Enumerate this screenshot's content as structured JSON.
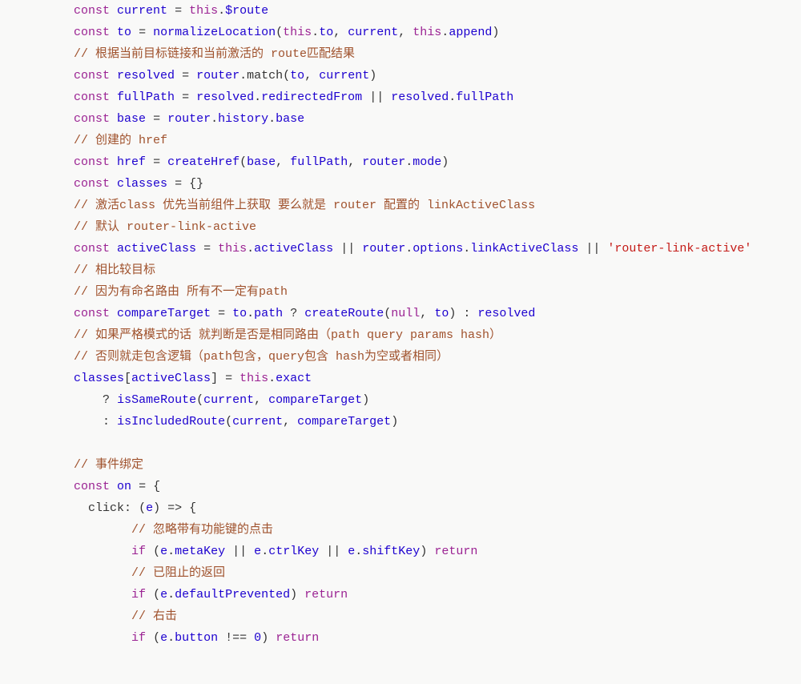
{
  "code": {
    "lines": [
      {
        "indent": 4,
        "tokens": [
          {
            "t": "kw",
            "v": "const"
          },
          {
            "t": "plain",
            "v": " "
          },
          {
            "t": "var",
            "v": "current"
          },
          {
            "t": "plain",
            "v": " "
          },
          {
            "t": "punct",
            "v": "="
          },
          {
            "t": "plain",
            "v": " "
          },
          {
            "t": "kw",
            "v": "this"
          },
          {
            "t": "punct",
            "v": "."
          },
          {
            "t": "var",
            "v": "$route"
          }
        ]
      },
      {
        "indent": 4,
        "tokens": [
          {
            "t": "kw",
            "v": "const"
          },
          {
            "t": "plain",
            "v": " "
          },
          {
            "t": "var",
            "v": "to"
          },
          {
            "t": "plain",
            "v": " "
          },
          {
            "t": "punct",
            "v": "="
          },
          {
            "t": "plain",
            "v": " "
          },
          {
            "t": "var",
            "v": "normalizeLocation"
          },
          {
            "t": "punct",
            "v": "("
          },
          {
            "t": "kw",
            "v": "this"
          },
          {
            "t": "punct",
            "v": "."
          },
          {
            "t": "var",
            "v": "to"
          },
          {
            "t": "punct",
            "v": ","
          },
          {
            "t": "plain",
            "v": " "
          },
          {
            "t": "var",
            "v": "current"
          },
          {
            "t": "punct",
            "v": ","
          },
          {
            "t": "plain",
            "v": " "
          },
          {
            "t": "kw",
            "v": "this"
          },
          {
            "t": "punct",
            "v": "."
          },
          {
            "t": "var",
            "v": "append"
          },
          {
            "t": "punct",
            "v": ")"
          }
        ]
      },
      {
        "indent": 4,
        "tokens": [
          {
            "t": "cmt",
            "v": "// 根据当前目标链接和当前激活的 route匹配结果"
          }
        ]
      },
      {
        "indent": 4,
        "tokens": [
          {
            "t": "kw",
            "v": "const"
          },
          {
            "t": "plain",
            "v": " "
          },
          {
            "t": "var",
            "v": "resolved"
          },
          {
            "t": "plain",
            "v": " "
          },
          {
            "t": "punct",
            "v": "="
          },
          {
            "t": "plain",
            "v": " "
          },
          {
            "t": "var",
            "v": "router"
          },
          {
            "t": "punct",
            "v": "."
          },
          {
            "t": "prop",
            "v": "match"
          },
          {
            "t": "punct",
            "v": "("
          },
          {
            "t": "var",
            "v": "to"
          },
          {
            "t": "punct",
            "v": ","
          },
          {
            "t": "plain",
            "v": " "
          },
          {
            "t": "var",
            "v": "current"
          },
          {
            "t": "punct",
            "v": ")"
          }
        ]
      },
      {
        "indent": 4,
        "tokens": [
          {
            "t": "kw",
            "v": "const"
          },
          {
            "t": "plain",
            "v": " "
          },
          {
            "t": "var",
            "v": "fullPath"
          },
          {
            "t": "plain",
            "v": " "
          },
          {
            "t": "punct",
            "v": "="
          },
          {
            "t": "plain",
            "v": " "
          },
          {
            "t": "var",
            "v": "resolved"
          },
          {
            "t": "punct",
            "v": "."
          },
          {
            "t": "var",
            "v": "redirectedFrom"
          },
          {
            "t": "plain",
            "v": " "
          },
          {
            "t": "punct",
            "v": "||"
          },
          {
            "t": "plain",
            "v": " "
          },
          {
            "t": "var",
            "v": "resolved"
          },
          {
            "t": "punct",
            "v": "."
          },
          {
            "t": "var",
            "v": "fullPath"
          }
        ]
      },
      {
        "indent": 4,
        "tokens": [
          {
            "t": "kw",
            "v": "const"
          },
          {
            "t": "plain",
            "v": " "
          },
          {
            "t": "var",
            "v": "base"
          },
          {
            "t": "plain",
            "v": " "
          },
          {
            "t": "punct",
            "v": "="
          },
          {
            "t": "plain",
            "v": " "
          },
          {
            "t": "var",
            "v": "router"
          },
          {
            "t": "punct",
            "v": "."
          },
          {
            "t": "var",
            "v": "history"
          },
          {
            "t": "punct",
            "v": "."
          },
          {
            "t": "var",
            "v": "base"
          }
        ]
      },
      {
        "indent": 4,
        "tokens": [
          {
            "t": "cmt",
            "v": "// 创建的 href"
          }
        ]
      },
      {
        "indent": 4,
        "tokens": [
          {
            "t": "kw",
            "v": "const"
          },
          {
            "t": "plain",
            "v": " "
          },
          {
            "t": "var",
            "v": "href"
          },
          {
            "t": "plain",
            "v": " "
          },
          {
            "t": "punct",
            "v": "="
          },
          {
            "t": "plain",
            "v": " "
          },
          {
            "t": "var",
            "v": "createHref"
          },
          {
            "t": "punct",
            "v": "("
          },
          {
            "t": "var",
            "v": "base"
          },
          {
            "t": "punct",
            "v": ","
          },
          {
            "t": "plain",
            "v": " "
          },
          {
            "t": "var",
            "v": "fullPath"
          },
          {
            "t": "punct",
            "v": ","
          },
          {
            "t": "plain",
            "v": " "
          },
          {
            "t": "var",
            "v": "router"
          },
          {
            "t": "punct",
            "v": "."
          },
          {
            "t": "var",
            "v": "mode"
          },
          {
            "t": "punct",
            "v": ")"
          }
        ]
      },
      {
        "indent": 4,
        "tokens": [
          {
            "t": "kw",
            "v": "const"
          },
          {
            "t": "plain",
            "v": " "
          },
          {
            "t": "var",
            "v": "classes"
          },
          {
            "t": "plain",
            "v": " "
          },
          {
            "t": "punct",
            "v": "="
          },
          {
            "t": "plain",
            "v": " "
          },
          {
            "t": "punct",
            "v": "{}"
          }
        ]
      },
      {
        "indent": 4,
        "tokens": [
          {
            "t": "cmt",
            "v": "// 激活class 优先当前组件上获取 要么就是 router 配置的 linkActiveClass"
          }
        ]
      },
      {
        "indent": 4,
        "tokens": [
          {
            "t": "cmt",
            "v": "// 默认 router-link-active"
          }
        ]
      },
      {
        "indent": 4,
        "wrap": true,
        "tokens": [
          {
            "t": "kw",
            "v": "const"
          },
          {
            "t": "plain",
            "v": " "
          },
          {
            "t": "var",
            "v": "activeClass"
          },
          {
            "t": "plain",
            "v": " "
          },
          {
            "t": "punct",
            "v": "="
          },
          {
            "t": "plain",
            "v": " "
          },
          {
            "t": "kw",
            "v": "this"
          },
          {
            "t": "punct",
            "v": "."
          },
          {
            "t": "var",
            "v": "activeClass"
          },
          {
            "t": "plain",
            "v": " "
          },
          {
            "t": "punct",
            "v": "||"
          },
          {
            "t": "plain",
            "v": " "
          },
          {
            "t": "var",
            "v": "router"
          },
          {
            "t": "punct",
            "v": "."
          },
          {
            "t": "var",
            "v": "options"
          },
          {
            "t": "punct",
            "v": "."
          },
          {
            "t": "var",
            "v": "linkActiveClass"
          },
          {
            "t": "plain",
            "v": " "
          },
          {
            "t": "punct",
            "v": "||"
          },
          {
            "t": "plain",
            "v": " "
          },
          {
            "t": "str",
            "v": "'router-link-active'"
          }
        ]
      },
      {
        "indent": 4,
        "tokens": [
          {
            "t": "cmt",
            "v": "// 相比较目标"
          }
        ]
      },
      {
        "indent": 4,
        "tokens": [
          {
            "t": "cmt",
            "v": "// 因为有命名路由 所有不一定有path"
          }
        ]
      },
      {
        "indent": 4,
        "tokens": [
          {
            "t": "kw",
            "v": "const"
          },
          {
            "t": "plain",
            "v": " "
          },
          {
            "t": "var",
            "v": "compareTarget"
          },
          {
            "t": "plain",
            "v": " "
          },
          {
            "t": "punct",
            "v": "="
          },
          {
            "t": "plain",
            "v": " "
          },
          {
            "t": "var",
            "v": "to"
          },
          {
            "t": "punct",
            "v": "."
          },
          {
            "t": "var",
            "v": "path"
          },
          {
            "t": "plain",
            "v": " "
          },
          {
            "t": "punct",
            "v": "?"
          },
          {
            "t": "plain",
            "v": " "
          },
          {
            "t": "var",
            "v": "createRoute"
          },
          {
            "t": "punct",
            "v": "("
          },
          {
            "t": "kw",
            "v": "null"
          },
          {
            "t": "punct",
            "v": ","
          },
          {
            "t": "plain",
            "v": " "
          },
          {
            "t": "var",
            "v": "to"
          },
          {
            "t": "punct",
            "v": ")"
          },
          {
            "t": "plain",
            "v": " "
          },
          {
            "t": "punct",
            "v": ":"
          },
          {
            "t": "plain",
            "v": " "
          },
          {
            "t": "var",
            "v": "resolved"
          }
        ]
      },
      {
        "indent": 4,
        "tokens": [
          {
            "t": "cmt",
            "v": "// 如果严格模式的话 就判断是否是相同路由（path query params hash）"
          }
        ]
      },
      {
        "indent": 4,
        "tokens": [
          {
            "t": "cmt",
            "v": "// 否则就走包含逻辑（path包含，query包含 hash为空或者相同）"
          }
        ]
      },
      {
        "indent": 4,
        "tokens": [
          {
            "t": "var",
            "v": "classes"
          },
          {
            "t": "punct",
            "v": "["
          },
          {
            "t": "var",
            "v": "activeClass"
          },
          {
            "t": "punct",
            "v": "]"
          },
          {
            "t": "plain",
            "v": " "
          },
          {
            "t": "punct",
            "v": "="
          },
          {
            "t": "plain",
            "v": " "
          },
          {
            "t": "kw",
            "v": "this"
          },
          {
            "t": "punct",
            "v": "."
          },
          {
            "t": "var",
            "v": "exact"
          }
        ]
      },
      {
        "indent": 6,
        "tokens": [
          {
            "t": "punct",
            "v": "?"
          },
          {
            "t": "plain",
            "v": " "
          },
          {
            "t": "var",
            "v": "isSameRoute"
          },
          {
            "t": "punct",
            "v": "("
          },
          {
            "t": "var",
            "v": "current"
          },
          {
            "t": "punct",
            "v": ","
          },
          {
            "t": "plain",
            "v": " "
          },
          {
            "t": "var",
            "v": "compareTarget"
          },
          {
            "t": "punct",
            "v": ")"
          }
        ]
      },
      {
        "indent": 6,
        "tokens": [
          {
            "t": "punct",
            "v": ":"
          },
          {
            "t": "plain",
            "v": " "
          },
          {
            "t": "var",
            "v": "isIncludedRoute"
          },
          {
            "t": "punct",
            "v": "("
          },
          {
            "t": "var",
            "v": "current"
          },
          {
            "t": "punct",
            "v": ","
          },
          {
            "t": "plain",
            "v": " "
          },
          {
            "t": "var",
            "v": "compareTarget"
          },
          {
            "t": "punct",
            "v": ")"
          }
        ]
      },
      {
        "indent": 0,
        "tokens": []
      },
      {
        "indent": 4,
        "tokens": [
          {
            "t": "cmt",
            "v": "// 事件绑定"
          }
        ]
      },
      {
        "indent": 4,
        "tokens": [
          {
            "t": "kw",
            "v": "const"
          },
          {
            "t": "plain",
            "v": " "
          },
          {
            "t": "var",
            "v": "on"
          },
          {
            "t": "plain",
            "v": " "
          },
          {
            "t": "punct",
            "v": "="
          },
          {
            "t": "plain",
            "v": " "
          },
          {
            "t": "punct",
            "v": "{"
          }
        ]
      },
      {
        "indent": 5,
        "tokens": [
          {
            "t": "prop",
            "v": "click"
          },
          {
            "t": "punct",
            "v": ":"
          },
          {
            "t": "plain",
            "v": " "
          },
          {
            "t": "punct",
            "v": "("
          },
          {
            "t": "var",
            "v": "e"
          },
          {
            "t": "punct",
            "v": ")"
          },
          {
            "t": "plain",
            "v": " "
          },
          {
            "t": "punct",
            "v": "=>"
          },
          {
            "t": "plain",
            "v": " "
          },
          {
            "t": "punct",
            "v": "{"
          }
        ]
      },
      {
        "indent": 8,
        "tokens": [
          {
            "t": "cmt",
            "v": "// 忽略带有功能键的点击"
          }
        ]
      },
      {
        "indent": 8,
        "tokens": [
          {
            "t": "kw",
            "v": "if"
          },
          {
            "t": "plain",
            "v": " "
          },
          {
            "t": "punct",
            "v": "("
          },
          {
            "t": "var",
            "v": "e"
          },
          {
            "t": "punct",
            "v": "."
          },
          {
            "t": "var",
            "v": "metaKey"
          },
          {
            "t": "plain",
            "v": " "
          },
          {
            "t": "punct",
            "v": "||"
          },
          {
            "t": "plain",
            "v": " "
          },
          {
            "t": "var",
            "v": "e"
          },
          {
            "t": "punct",
            "v": "."
          },
          {
            "t": "var",
            "v": "ctrlKey"
          },
          {
            "t": "plain",
            "v": " "
          },
          {
            "t": "punct",
            "v": "||"
          },
          {
            "t": "plain",
            "v": " "
          },
          {
            "t": "var",
            "v": "e"
          },
          {
            "t": "punct",
            "v": "."
          },
          {
            "t": "var",
            "v": "shiftKey"
          },
          {
            "t": "punct",
            "v": ")"
          },
          {
            "t": "plain",
            "v": " "
          },
          {
            "t": "kw",
            "v": "return"
          }
        ]
      },
      {
        "indent": 8,
        "tokens": [
          {
            "t": "cmt",
            "v": "// 已阻止的返回"
          }
        ]
      },
      {
        "indent": 8,
        "tokens": [
          {
            "t": "kw",
            "v": "if"
          },
          {
            "t": "plain",
            "v": " "
          },
          {
            "t": "punct",
            "v": "("
          },
          {
            "t": "var",
            "v": "e"
          },
          {
            "t": "punct",
            "v": "."
          },
          {
            "t": "var",
            "v": "defaultPrevented"
          },
          {
            "t": "punct",
            "v": ")"
          },
          {
            "t": "plain",
            "v": " "
          },
          {
            "t": "kw",
            "v": "return"
          }
        ]
      },
      {
        "indent": 8,
        "tokens": [
          {
            "t": "cmt",
            "v": "// 右击"
          }
        ]
      },
      {
        "indent": 8,
        "tokens": [
          {
            "t": "kw",
            "v": "if"
          },
          {
            "t": "plain",
            "v": " "
          },
          {
            "t": "punct",
            "v": "("
          },
          {
            "t": "var",
            "v": "e"
          },
          {
            "t": "punct",
            "v": "."
          },
          {
            "t": "var",
            "v": "button"
          },
          {
            "t": "plain",
            "v": " "
          },
          {
            "t": "punct",
            "v": "!=="
          },
          {
            "t": "plain",
            "v": " "
          },
          {
            "t": "num",
            "v": "0"
          },
          {
            "t": "punct",
            "v": ")"
          },
          {
            "t": "plain",
            "v": " "
          },
          {
            "t": "kw",
            "v": "return"
          }
        ]
      }
    ]
  }
}
